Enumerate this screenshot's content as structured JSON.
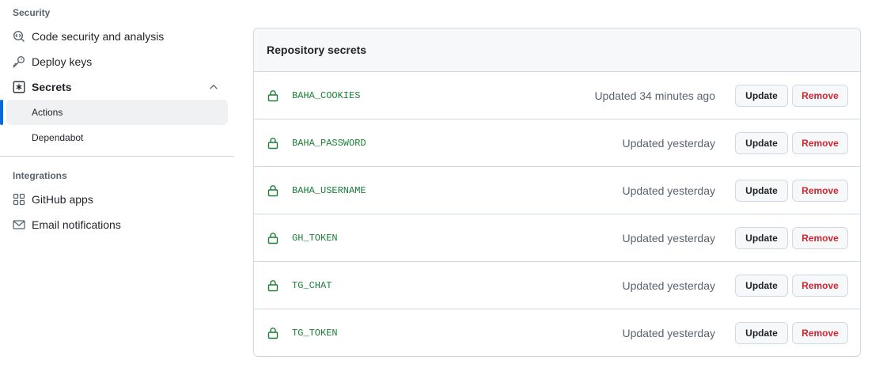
{
  "sidebar": {
    "security_heading": "Security",
    "integrations_heading": "Integrations",
    "items": [
      {
        "label": "Code security and analysis",
        "icon": "codescan-icon"
      },
      {
        "label": "Deploy keys",
        "icon": "key-icon"
      },
      {
        "label": "Secrets",
        "icon": "asterisk-icon",
        "expanded": true
      },
      {
        "label": "GitHub apps",
        "icon": "apps-icon"
      },
      {
        "label": "Email notifications",
        "icon": "mail-icon"
      }
    ],
    "secrets_subitems": [
      {
        "label": "Actions",
        "active": true
      },
      {
        "label": "Dependabot",
        "active": false
      }
    ]
  },
  "secrets": {
    "title": "Repository secrets",
    "update_label": "Update",
    "remove_label": "Remove",
    "rows": [
      {
        "name": "BAHA_COOKIES",
        "updated": "Updated 34 minutes ago"
      },
      {
        "name": "BAHA_PASSWORD",
        "updated": "Updated yesterday"
      },
      {
        "name": "BAHA_USERNAME",
        "updated": "Updated yesterday"
      },
      {
        "name": "GH_TOKEN",
        "updated": "Updated yesterday"
      },
      {
        "name": "TG_CHAT",
        "updated": "Updated yesterday"
      },
      {
        "name": "TG_TOKEN",
        "updated": "Updated yesterday"
      }
    ]
  },
  "colors": {
    "accent": "#0969da",
    "secret_green": "#1a7f37",
    "danger": "#d1242f",
    "muted": "#59636e"
  }
}
